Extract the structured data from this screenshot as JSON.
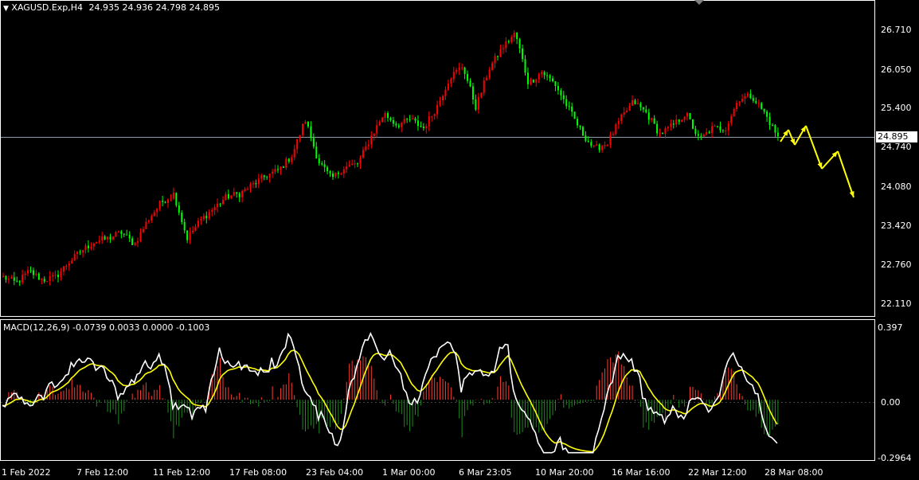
{
  "main_chart": {
    "header_symbol": "XAGUSD.Exp,H4",
    "header_ohlc": "24.935 24.936 24.798 24.895",
    "price_axis_labels": [
      "26.710",
      "26.050",
      "25.400",
      "24.740",
      "24.080",
      "23.420",
      "22.760",
      "22.110"
    ],
    "current_price": "24.895",
    "bull_color": "#00ff00",
    "bear_color": "#ff0000",
    "arrow_color": "#ffff00"
  },
  "macd": {
    "header": "MACD(12,26,9) -0.0739 0.0033 0.0000 -0.1003",
    "axis_labels": [
      "0.397",
      "0.00",
      "-0.2964"
    ],
    "macd_line_color": "#ffffff",
    "signal_line_color": "#ffff00",
    "hist_up_color": "#ff3b30",
    "hist_down_color": "#1f8a1f"
  },
  "time_axis": {
    "labels": [
      "1 Feb 2022",
      "7 Feb 12:00",
      "11 Feb 12:00",
      "17 Feb 08:00",
      "23 Feb 04:00",
      "1 Mar 00:00",
      "6 Mar 23:05",
      "10 Mar 20:00",
      "16 Mar 16:00",
      "22 Mar 12:00",
      "28 Mar 08:00"
    ]
  },
  "chart_data": {
    "type": "candlestick",
    "symbol": "XAGUSD.Exp",
    "timeframe": "H4",
    "ylim": [
      22.11,
      26.71
    ],
    "close_path": [
      22.55,
      22.45,
      22.65,
      22.5,
      22.55,
      22.8,
      23.0,
      23.15,
      23.2,
      23.3,
      23.1,
      23.5,
      23.8,
      23.95,
      23.2,
      23.5,
      23.7,
      23.9,
      23.95,
      24.1,
      24.25,
      24.35,
      24.6,
      25.2,
      24.5,
      24.2,
      24.4,
      24.45,
      24.9,
      25.3,
      25.1,
      25.2,
      25.05,
      25.4,
      25.9,
      26.1,
      25.4,
      26.05,
      26.4,
      26.65,
      25.8,
      26.0,
      25.8,
      25.4,
      25.0,
      24.7,
      24.8,
      25.2,
      25.5,
      25.3,
      24.95,
      25.1,
      25.3,
      24.85,
      25.05,
      25.05,
      25.55,
      25.6,
      25.3,
      24.9
    ],
    "macd_header_values": [
      -0.0739,
      0.0033,
      0.0,
      -0.1003
    ],
    "macd_range": [
      -0.2964,
      0.397
    ]
  }
}
